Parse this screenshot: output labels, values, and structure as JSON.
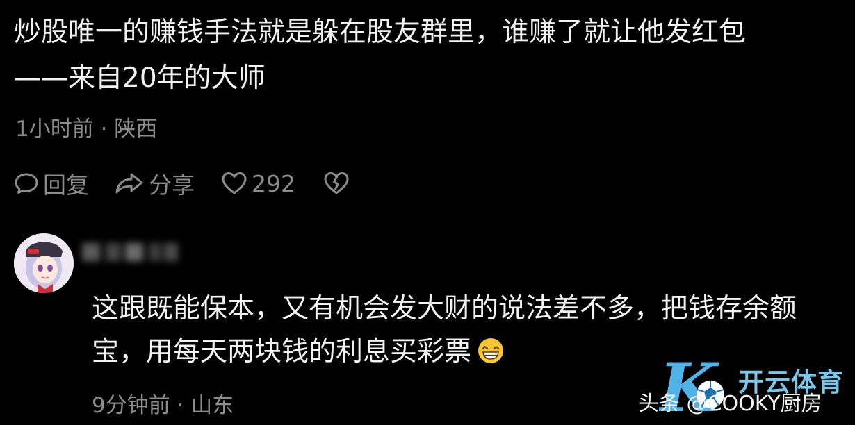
{
  "post": {
    "text": "炒股唯一的赚钱手法就是躲在股友群里，谁赚了就让他发红包\n——来自20年的大师",
    "meta": "1小时前 · 陕西",
    "actions": {
      "reply_label": "回复",
      "share_label": "分享",
      "like_count": "292"
    }
  },
  "comment": {
    "text": "这跟既能保本，又有机会发大财的说法差不多，把钱存余额宝，用每天两块钱的利息买彩票",
    "emoji": "grinning-face-emoji",
    "meta": "9分钟前 · 山东"
  },
  "watermark": {
    "brand_text": "开云体育",
    "source_text": "头条 @COOKY厨房",
    "logo_letter": "K",
    "accent_color": "#4fb3e8"
  },
  "colors": {
    "background": "#000000",
    "primary_text": "#f2f2f2",
    "secondary_text": "#8c8c8c"
  },
  "icons": {
    "reply": "speech-bubble-icon",
    "share": "share-arrow-icon",
    "like": "heart-outline-icon",
    "dislike": "broken-heart-icon"
  }
}
